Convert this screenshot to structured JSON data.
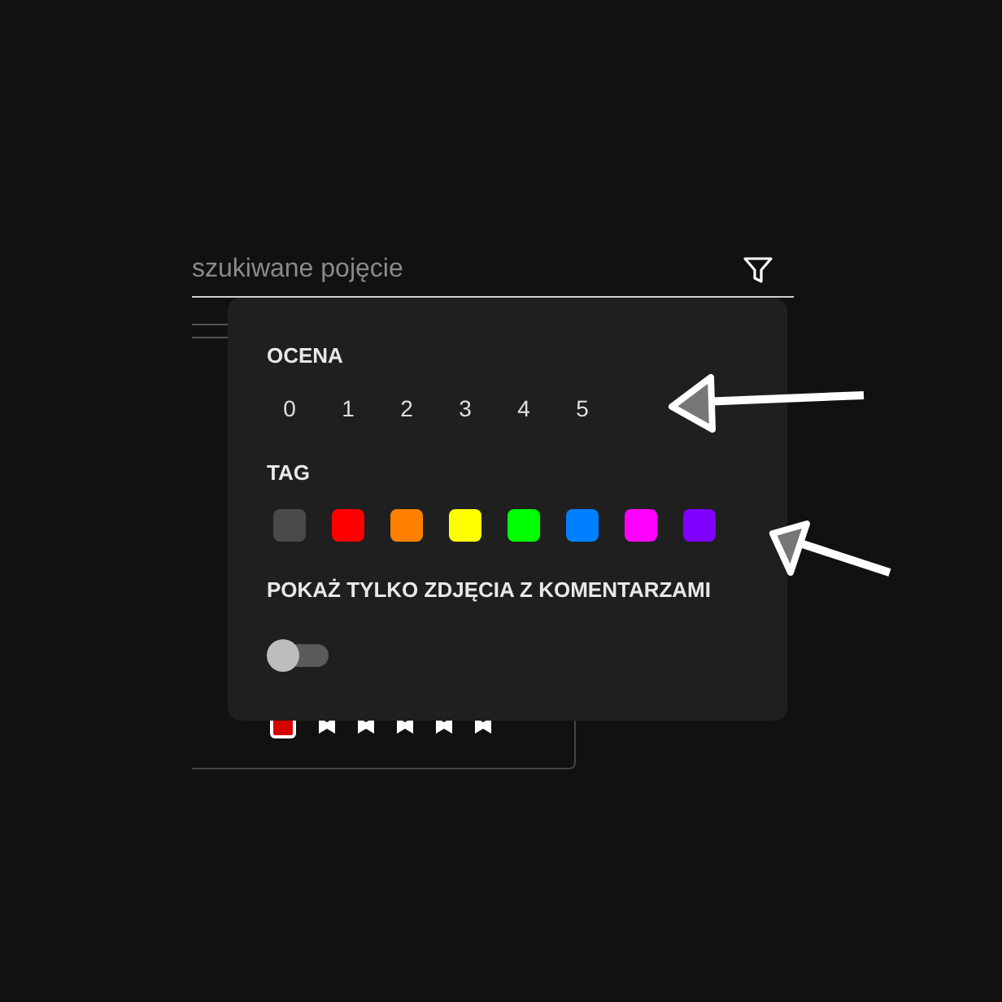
{
  "search": {
    "placeholder": "szukiwane pojęcie"
  },
  "photo_card": {
    "tag": {
      "color": "#d40000"
    },
    "stars": 5
  },
  "filter_popup": {
    "rating": {
      "label": "OCENA",
      "options": [
        {
          "label": "0",
          "selected": false
        },
        {
          "label": "1",
          "selected": false
        },
        {
          "label": "2",
          "selected": false
        },
        {
          "label": "3",
          "selected": false
        },
        {
          "label": "4",
          "selected": false
        },
        {
          "label": "5",
          "selected": false
        }
      ]
    },
    "tag": {
      "label": "TAG",
      "options": [
        {
          "color": "#4a4a4a",
          "selected": false
        },
        {
          "color": "#ff0000",
          "selected": false
        },
        {
          "color": "#ff8000",
          "selected": false
        },
        {
          "color": "#ffff00",
          "selected": false
        },
        {
          "color": "#00ff00",
          "selected": false
        },
        {
          "color": "#0080ff",
          "selected": false
        },
        {
          "color": "#ff00ff",
          "selected": false
        },
        {
          "color": "#8000ff",
          "selected": false
        }
      ]
    },
    "comments_only": {
      "label": "POKAŻ TYLKO ZDJĘCIA Z KOMENTARZAMI",
      "on": false
    }
  }
}
